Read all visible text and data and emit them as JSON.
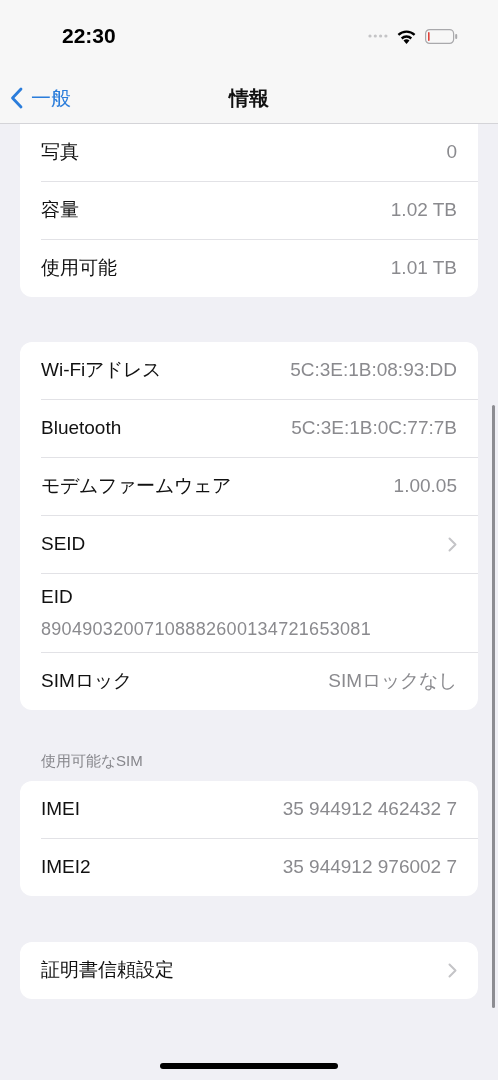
{
  "status_bar": {
    "time": "22:30"
  },
  "nav": {
    "back_label": "一般",
    "title": "情報"
  },
  "groups": [
    {
      "cut_top": true,
      "rows": [
        {
          "kind": "value",
          "label": "写真",
          "value": "0"
        },
        {
          "kind": "value",
          "label": "容量",
          "value": "1.02 TB"
        },
        {
          "kind": "value",
          "label": "使用可能",
          "value": "1.01 TB"
        }
      ]
    },
    {
      "rows": [
        {
          "kind": "value",
          "label": "Wi-Fiアドレス",
          "value": "5C:3E:1B:08:93:DD"
        },
        {
          "kind": "value",
          "label": "Bluetooth",
          "value": "5C:3E:1B:0C:77:7B"
        },
        {
          "kind": "value",
          "label": "モデムファームウェア",
          "value": "1.00.05"
        },
        {
          "kind": "chevron",
          "label": "SEID"
        },
        {
          "kind": "stacked",
          "label": "EID",
          "value": "89049032007108882600134721653081"
        },
        {
          "kind": "value",
          "label": "SIMロック",
          "value": "SIMロックなし"
        }
      ]
    },
    {
      "header": "使用可能なSIM",
      "rows": [
        {
          "kind": "value",
          "label": "IMEI",
          "value": "35 944912 462432 7"
        },
        {
          "kind": "value",
          "label": "IMEI2",
          "value": "35 944912 976002 7"
        }
      ]
    },
    {
      "rows": [
        {
          "kind": "chevron",
          "label": "証明書信頼設定"
        }
      ]
    }
  ]
}
